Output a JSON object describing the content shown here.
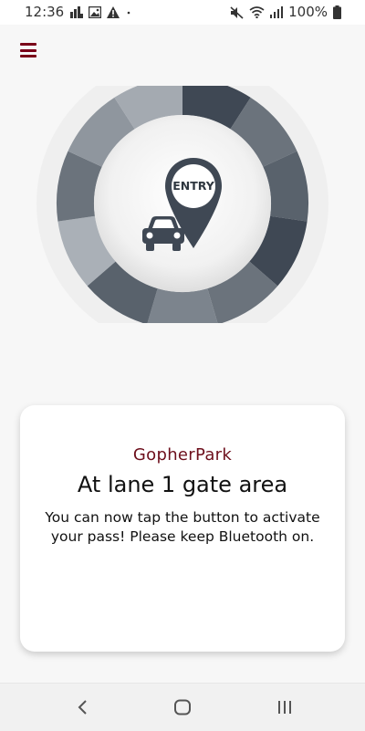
{
  "status_bar": {
    "time": "12:36",
    "battery_percent": "100%",
    "left_icons": [
      "data-saver-icon",
      "gallery-icon",
      "warning-icon",
      "dot-icon"
    ],
    "right_icons": [
      "mute-icon",
      "wifi-icon",
      "signal-icon",
      "battery-icon"
    ]
  },
  "header": {
    "menu_icon": "hamburger-menu-icon",
    "accent_color": "#7a0019"
  },
  "dial": {
    "badge_text": "ENTRY",
    "icons": [
      "location-pin-icon",
      "car-icon"
    ],
    "segment_colors": [
      "#3f4854",
      "#6b737c",
      "#59626c",
      "#3f4854",
      "#6b737c",
      "#7c848d",
      "#59626c",
      "#aab0b7",
      "#6b737c",
      "#8f969e",
      "#a4aab1"
    ]
  },
  "card": {
    "brand": "GopherPark",
    "title": "At lane 1 gate area",
    "message": "You can now tap the button to activate your pass! Please keep Bluetooth on."
  },
  "nav_bar": {
    "buttons": [
      "back-icon",
      "home-icon",
      "recents-icon"
    ]
  }
}
